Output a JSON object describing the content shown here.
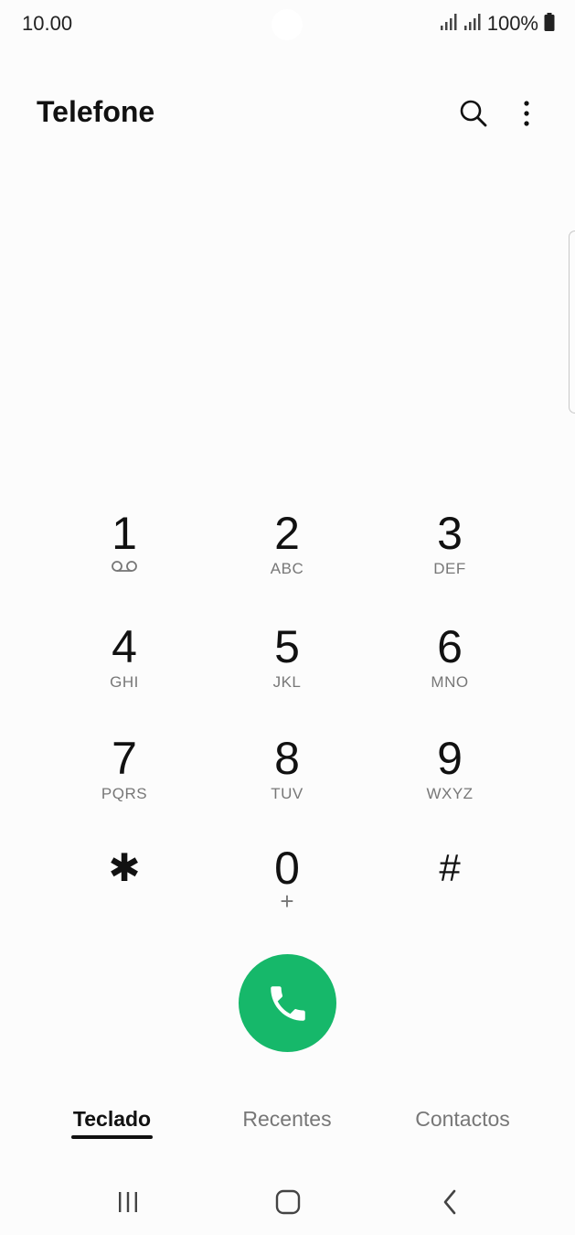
{
  "status_bar": {
    "time": "10.00",
    "battery": "100%",
    "icons": [
      "signal-icon",
      "signal-icon",
      "battery-icon"
    ]
  },
  "header": {
    "title": "Telefone",
    "icons": [
      "search-icon",
      "more-vertical-icon"
    ]
  },
  "keypad": {
    "keys": [
      {
        "digit": "1",
        "letters": "",
        "icon": "voicemail-icon"
      },
      {
        "digit": "2",
        "letters": "ABC"
      },
      {
        "digit": "3",
        "letters": "DEF"
      },
      {
        "digit": "4",
        "letters": "GHI"
      },
      {
        "digit": "5",
        "letters": "JKL"
      },
      {
        "digit": "6",
        "letters": "MNO"
      },
      {
        "digit": "7",
        "letters": "PQRS"
      },
      {
        "digit": "8",
        "letters": "TUV"
      },
      {
        "digit": "9",
        "letters": "WXYZ"
      },
      {
        "digit": "✱",
        "letters": ""
      },
      {
        "digit": "0",
        "letters": "+"
      },
      {
        "digit": "#",
        "letters": ""
      }
    ]
  },
  "call_button": {
    "icon": "phone-icon",
    "color": "#16b86a"
  },
  "tabs": [
    {
      "label": "Teclado",
      "active": true
    },
    {
      "label": "Recentes",
      "active": false
    },
    {
      "label": "Contactos",
      "active": false
    }
  ],
  "nav_bar": {
    "icons": [
      "recent-apps-icon",
      "home-icon",
      "back-icon"
    ]
  }
}
